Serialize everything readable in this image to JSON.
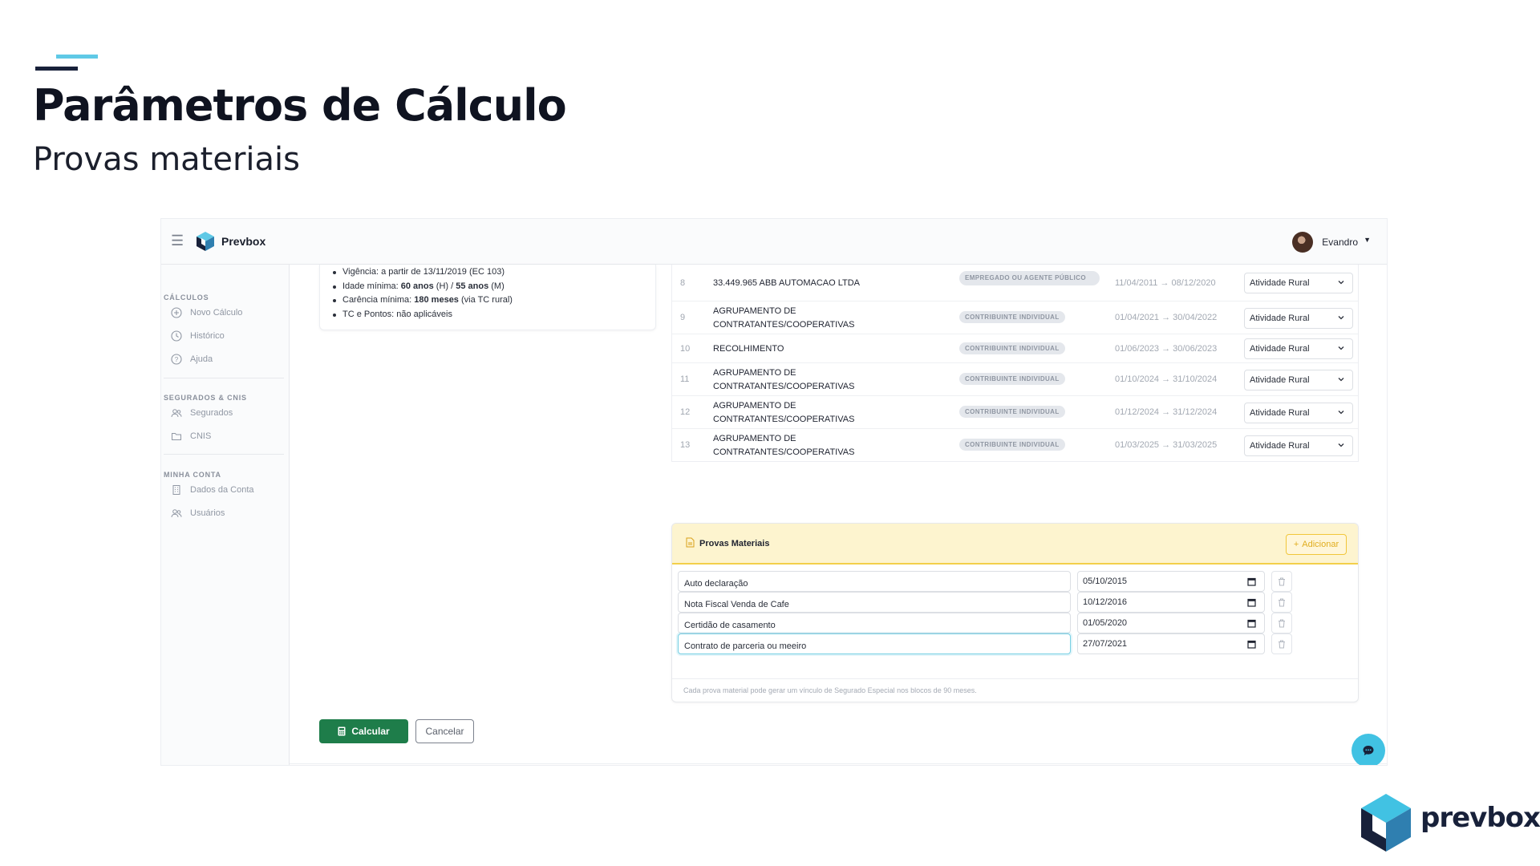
{
  "slide": {
    "title": "Parâmetros de Cálculo",
    "subtitle": "Provas materiais"
  },
  "colors": {
    "brand_dark": "#18213a",
    "brand_cyan": "#5fc9e6",
    "primary_green": "#1e7d4a",
    "warning_yellow": "#f3cf4a",
    "fab": "#41c2e3"
  },
  "topbar": {
    "menu_icon": "hamburger-icon",
    "brand": "Prevbox",
    "user_name": "Evandro"
  },
  "sidebar": {
    "sections": [
      {
        "title": "CÁLCULOS",
        "items": [
          {
            "label": "Novo Cálculo",
            "icon": "plus-circle-icon"
          },
          {
            "label": "Histórico",
            "icon": "clock-icon"
          },
          {
            "label": "Ajuda",
            "icon": "help-circle-icon"
          }
        ]
      },
      {
        "title": "SEGURADOS & CNIS",
        "items": [
          {
            "label": "Segurados",
            "icon": "users-icon"
          },
          {
            "label": "CNIS",
            "icon": "folder-icon"
          }
        ]
      },
      {
        "title": "MINHA CONTA",
        "items": [
          {
            "label": "Dados da Conta",
            "icon": "building-icon"
          },
          {
            "label": "Usuários",
            "icon": "users-icon"
          }
        ]
      }
    ]
  },
  "rules": {
    "vigencia": "Vigência: a partir de 13/11/2019 (EC 103)",
    "idade_label": "Idade mínima: ",
    "idade_h": "60 anos",
    "idade_mid": " (H) / ",
    "idade_m": "55 anos",
    "idade_end": " (M)",
    "carencia_label": "Carência mínima: ",
    "carencia_value": "180 meses",
    "carencia_end": " (via TC rural)",
    "tc": "TC e Pontos: não aplicáveis"
  },
  "vinculos": [
    {
      "num": "8",
      "name": "33.449.965 ABB AUTOMACAO LTDA",
      "type": "EMPREGADO OU AGENTE PÚBLICO",
      "period": "11/04/2011 → 08/12/2020",
      "activity": "Atividade Rural"
    },
    {
      "num": "9",
      "name": "AGRUPAMENTO DE CONTRATANTES/COOPERATIVAS",
      "type": "CONTRIBUINTE INDIVIDUAL",
      "period": "01/04/2021 → 30/04/2022",
      "activity": "Atividade Rural"
    },
    {
      "num": "10",
      "name": "RECOLHIMENTO",
      "type": "CONTRIBUINTE INDIVIDUAL",
      "period": "01/06/2023 → 30/06/2023",
      "activity": "Atividade Rural"
    },
    {
      "num": "11",
      "name": "AGRUPAMENTO DE CONTRATANTES/COOPERATIVAS",
      "type": "CONTRIBUINTE INDIVIDUAL",
      "period": "01/10/2024 → 31/10/2024",
      "activity": "Atividade Rural"
    },
    {
      "num": "12",
      "name": "AGRUPAMENTO DE CONTRATANTES/COOPERATIVAS",
      "type": "CONTRIBUINTE INDIVIDUAL",
      "period": "01/12/2024 → 31/12/2024",
      "activity": "Atividade Rural"
    },
    {
      "num": "13",
      "name": "AGRUPAMENTO DE CONTRATANTES/COOPERATIVAS",
      "type": "CONTRIBUINTE INDIVIDUAL",
      "period": "01/03/2025 → 31/03/2025",
      "activity": "Atividade Rural"
    }
  ],
  "provas": {
    "title": "Provas Materiais",
    "add_label": "Adicionar",
    "items": [
      {
        "description": "Auto declaração",
        "date": "05/10/2015"
      },
      {
        "description": "Nota Fiscal Venda de Cafe",
        "date": "10/12/2016"
      },
      {
        "description": "Certidão de casamento",
        "date": "01/05/2020"
      },
      {
        "description": "Contrato de parceria ou meeiro",
        "date": "27/07/2021"
      }
    ],
    "note": "Cada prova material pode gerar um vínculo de Segurado Especial nos blocos de 90 meses."
  },
  "actions": {
    "calculate": "Calcular",
    "cancel": "Cancelar"
  },
  "corner": {
    "brand": "prevbox"
  }
}
